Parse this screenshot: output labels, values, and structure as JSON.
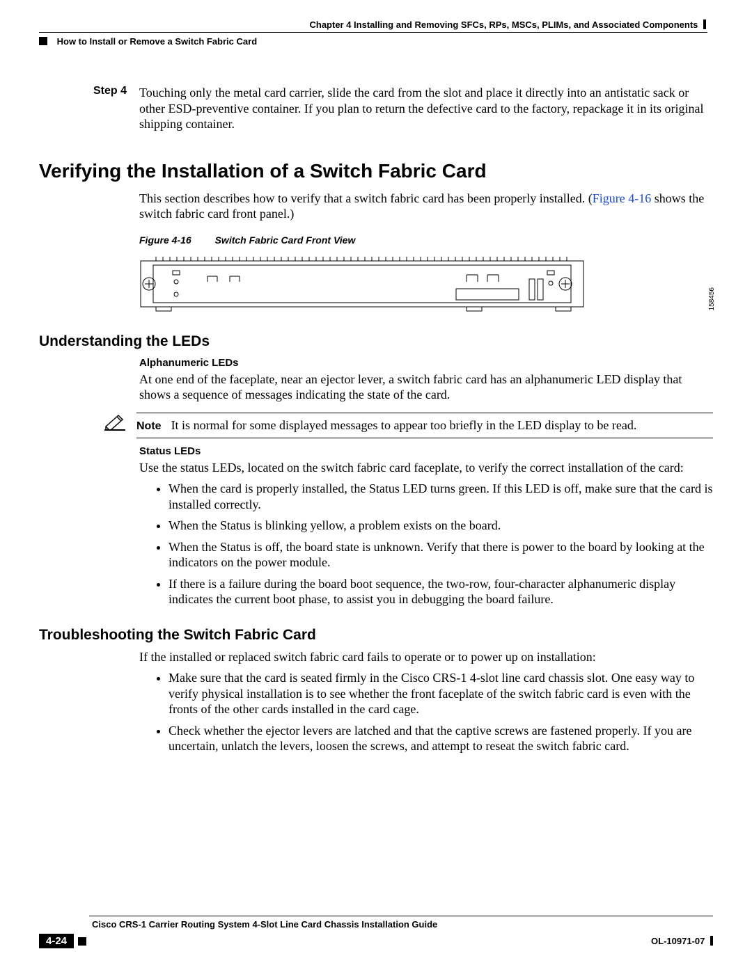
{
  "header": {
    "chapter": "Chapter 4      Installing and Removing SFCs, RPs, MSCs, PLIMs, and Associated Components",
    "section": "How to Install or Remove a Switch Fabric Card"
  },
  "step": {
    "label": "Step 4",
    "text": "Touching only the metal card carrier, slide the card from the slot and place it directly into an antistatic sack or other ESD-preventive container. If you plan to return the defective card to the factory, repackage it in its original shipping container."
  },
  "h1": "Verifying the Installation of a Switch Fabric Card",
  "intro_a": "This section describes how to verify that a switch fabric card has been properly installed. (",
  "intro_link": "Figure 4-16",
  "intro_b": " shows the switch fabric card front panel.)",
  "figure": {
    "num": "Figure 4-16",
    "title": "Switch Fabric Card Front View",
    "id": "158456"
  },
  "h2_leds": "Understanding the LEDs",
  "h3_alpha": "Alphanumeric LEDs",
  "alpha_text": "At one end of the faceplate, near an ejector lever, a switch fabric card has an alphanumeric LED display that shows a sequence of messages indicating the state of the card.",
  "note": {
    "label": "Note",
    "text": "It is normal for some displayed messages to appear too briefly in the LED display to be read."
  },
  "h3_status": "Status LEDs",
  "status_intro": "Use the status LEDs, located on the switch fabric card faceplate, to verify the correct installation of the card:",
  "status_bullets": [
    "When the card is properly installed, the Status LED turns green. If this LED is off, make sure that the card is installed correctly.",
    "When the Status is blinking yellow, a problem exists on the board.",
    "When the Status is off, the board state is unknown. Verify that there is power to the board by looking at the indicators on the power module.",
    "If there is a failure during the board boot sequence, the two-row, four-character alphanumeric display indicates the current boot phase, to assist you in debugging the board failure."
  ],
  "h2_trouble": "Troubleshooting the Switch Fabric Card",
  "trouble_intro": "If the installed or replaced switch fabric card fails to operate or to power up on installation:",
  "trouble_bullets": [
    "Make sure that the card is seated firmly in the Cisco CRS-1 4-slot line card chassis slot. One easy way to verify physical installation is to see whether the front faceplate of the switch fabric card is even with the fronts of the other cards installed in the card cage.",
    "Check whether the ejector levers are latched and that the captive screws are fastened properly. If you are uncertain, unlatch the levers, loosen the screws, and attempt to reseat the switch fabric card."
  ],
  "footer": {
    "book": "Cisco CRS-1 Carrier Routing System 4-Slot Line Card Chassis Installation Guide",
    "page": "4-24",
    "doc": "OL-10971-07"
  }
}
